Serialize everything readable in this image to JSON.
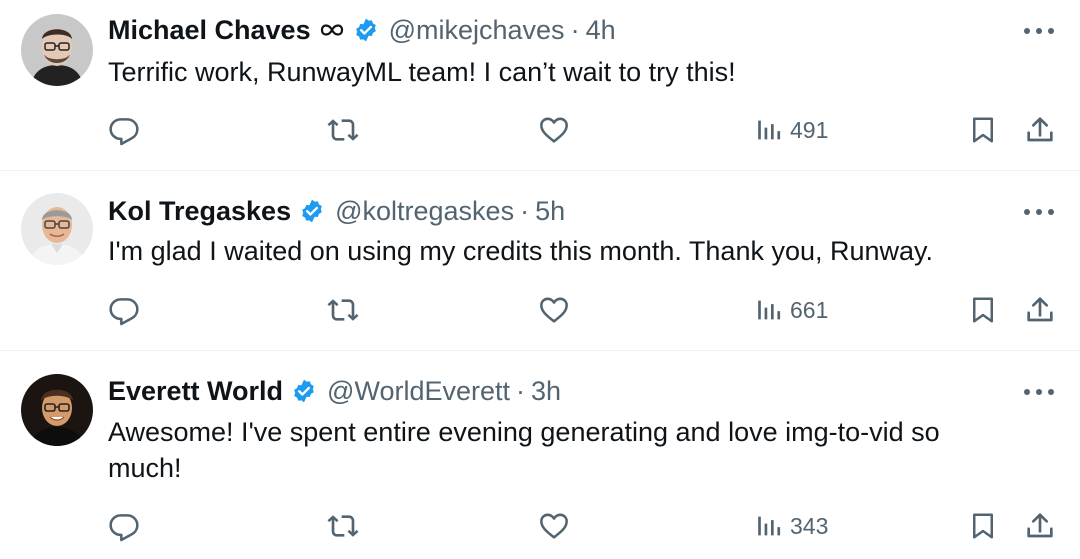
{
  "tweets": [
    {
      "name": "Michael Chaves",
      "handle": "@mikejchaves",
      "separator": "·",
      "time": "4h",
      "text": "Terrific work, RunwayML team! I can’t wait to try this!",
      "views": "491",
      "name_glyph": "infinity-icon",
      "verified": true
    },
    {
      "name": "Kol Tregaskes",
      "handle": "@koltregaskes",
      "separator": "·",
      "time": "5h",
      "text": "I'm glad I waited on using my credits this month.  Thank you, Runway.",
      "views": "661",
      "verified": true
    },
    {
      "name": "Everett World",
      "handle": "@WorldEverett",
      "separator": "·",
      "time": "3h",
      "text": "Awesome! I've spent entire evening generating and love img-to-vid so much!",
      "views": "343",
      "verified": true
    }
  ],
  "colors": {
    "verified_badge": "#1d9bf0",
    "secondary_text": "#536471",
    "primary_text": "#0f1419",
    "divider": "#eff3f4"
  },
  "icons": {
    "reply": "reply-icon",
    "retweet": "retweet-icon",
    "like": "heart-icon",
    "views": "views-chart-icon",
    "bookmark": "bookmark-icon",
    "share": "share-icon",
    "more": "more-options-icon"
  }
}
